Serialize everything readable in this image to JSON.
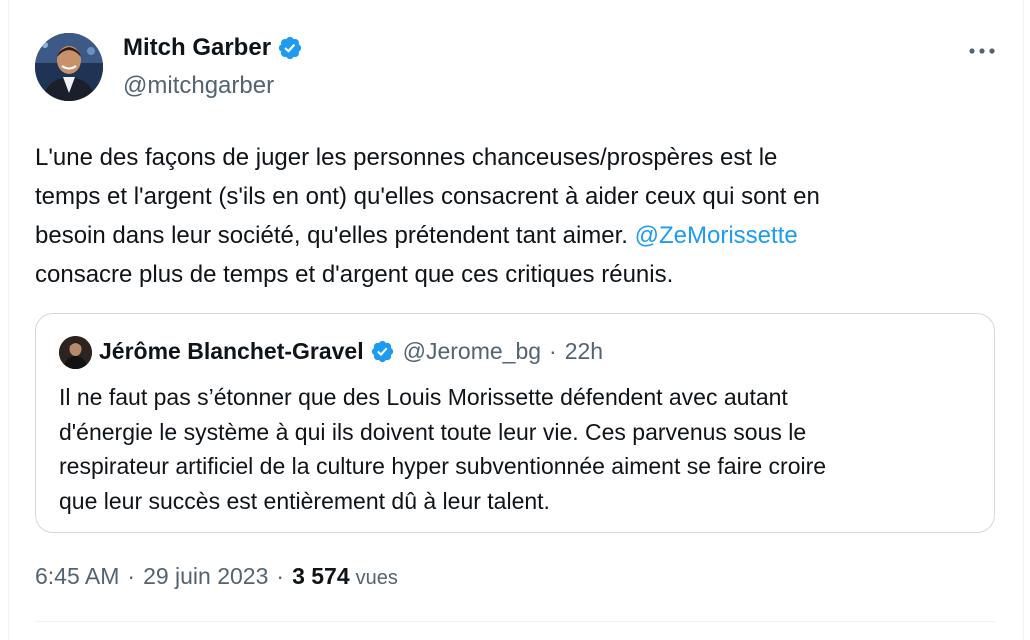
{
  "tweet": {
    "author": {
      "display_name": "Mitch Garber",
      "handle": "@mitchgarber",
      "verified": true,
      "avatar_icon": "profile-photo"
    },
    "more_icon": "more-horizontal-icon",
    "text_lines": [
      "L'une des façons de juger les personnes chanceuses/prospères est le",
      "temps et l'argent (s'ils en ont) qu'elles consacrent à aider ceux qui sont en",
      "besoin dans leur société, qu'elles prétendent tant aimer.",
      "consacre plus de temps et d'argent que ces critiques réunis."
    ],
    "mention": "@ZeMorissette",
    "quote": {
      "author": {
        "display_name": "Jérôme Blanchet-Gravel",
        "handle": "@Jerome_bg",
        "verified": true
      },
      "separator": "·",
      "time": "22h",
      "text_lines": [
        "Il ne faut pas s’étonner que des Louis Morissette défendent avec autant",
        "d'énergie le système à qui ils doivent toute leur vie. Ces parvenus sous le",
        "respirateur artificiel de la culture hyper subventionnée aiment se faire croire",
        "que leur succès est entièrement dû à leur talent."
      ]
    },
    "meta": {
      "time": "6:45 AM",
      "separator": "·",
      "date": "29 juin 2023",
      "views_count": "3 574",
      "views_label": "vues"
    },
    "colors": {
      "link": "#1d9bf0",
      "verified": "#1d9bf0",
      "secondary_text": "#536471",
      "primary_text": "#0f1419",
      "border": "#cfd9de"
    }
  }
}
